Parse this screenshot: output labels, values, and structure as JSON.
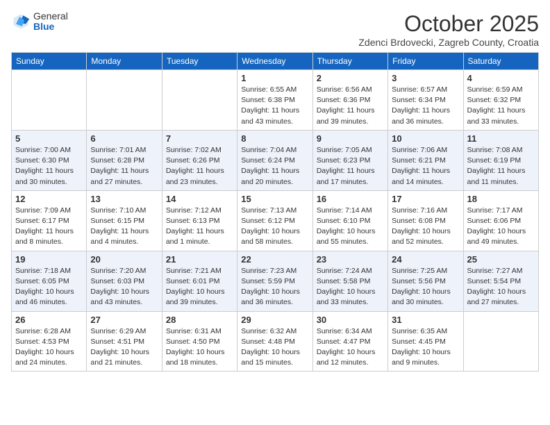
{
  "header": {
    "logo_general": "General",
    "logo_blue": "Blue",
    "month_title": "October 2025",
    "subtitle": "Zdenci Brdovecki, Zagreb County, Croatia"
  },
  "weekdays": [
    "Sunday",
    "Monday",
    "Tuesday",
    "Wednesday",
    "Thursday",
    "Friday",
    "Saturday"
  ],
  "weeks": [
    [
      {
        "day": "",
        "sunrise": "",
        "sunset": "",
        "daylight": ""
      },
      {
        "day": "",
        "sunrise": "",
        "sunset": "",
        "daylight": ""
      },
      {
        "day": "",
        "sunrise": "",
        "sunset": "",
        "daylight": ""
      },
      {
        "day": "1",
        "sunrise": "Sunrise: 6:55 AM",
        "sunset": "Sunset: 6:38 PM",
        "daylight": "Daylight: 11 hours and 43 minutes."
      },
      {
        "day": "2",
        "sunrise": "Sunrise: 6:56 AM",
        "sunset": "Sunset: 6:36 PM",
        "daylight": "Daylight: 11 hours and 39 minutes."
      },
      {
        "day": "3",
        "sunrise": "Sunrise: 6:57 AM",
        "sunset": "Sunset: 6:34 PM",
        "daylight": "Daylight: 11 hours and 36 minutes."
      },
      {
        "day": "4",
        "sunrise": "Sunrise: 6:59 AM",
        "sunset": "Sunset: 6:32 PM",
        "daylight": "Daylight: 11 hours and 33 minutes."
      }
    ],
    [
      {
        "day": "5",
        "sunrise": "Sunrise: 7:00 AM",
        "sunset": "Sunset: 6:30 PM",
        "daylight": "Daylight: 11 hours and 30 minutes."
      },
      {
        "day": "6",
        "sunrise": "Sunrise: 7:01 AM",
        "sunset": "Sunset: 6:28 PM",
        "daylight": "Daylight: 11 hours and 27 minutes."
      },
      {
        "day": "7",
        "sunrise": "Sunrise: 7:02 AM",
        "sunset": "Sunset: 6:26 PM",
        "daylight": "Daylight: 11 hours and 23 minutes."
      },
      {
        "day": "8",
        "sunrise": "Sunrise: 7:04 AM",
        "sunset": "Sunset: 6:24 PM",
        "daylight": "Daylight: 11 hours and 20 minutes."
      },
      {
        "day": "9",
        "sunrise": "Sunrise: 7:05 AM",
        "sunset": "Sunset: 6:23 PM",
        "daylight": "Daylight: 11 hours and 17 minutes."
      },
      {
        "day": "10",
        "sunrise": "Sunrise: 7:06 AM",
        "sunset": "Sunset: 6:21 PM",
        "daylight": "Daylight: 11 hours and 14 minutes."
      },
      {
        "day": "11",
        "sunrise": "Sunrise: 7:08 AM",
        "sunset": "Sunset: 6:19 PM",
        "daylight": "Daylight: 11 hours and 11 minutes."
      }
    ],
    [
      {
        "day": "12",
        "sunrise": "Sunrise: 7:09 AM",
        "sunset": "Sunset: 6:17 PM",
        "daylight": "Daylight: 11 hours and 8 minutes."
      },
      {
        "day": "13",
        "sunrise": "Sunrise: 7:10 AM",
        "sunset": "Sunset: 6:15 PM",
        "daylight": "Daylight: 11 hours and 4 minutes."
      },
      {
        "day": "14",
        "sunrise": "Sunrise: 7:12 AM",
        "sunset": "Sunset: 6:13 PM",
        "daylight": "Daylight: 11 hours and 1 minute."
      },
      {
        "day": "15",
        "sunrise": "Sunrise: 7:13 AM",
        "sunset": "Sunset: 6:12 PM",
        "daylight": "Daylight: 10 hours and 58 minutes."
      },
      {
        "day": "16",
        "sunrise": "Sunrise: 7:14 AM",
        "sunset": "Sunset: 6:10 PM",
        "daylight": "Daylight: 10 hours and 55 minutes."
      },
      {
        "day": "17",
        "sunrise": "Sunrise: 7:16 AM",
        "sunset": "Sunset: 6:08 PM",
        "daylight": "Daylight: 10 hours and 52 minutes."
      },
      {
        "day": "18",
        "sunrise": "Sunrise: 7:17 AM",
        "sunset": "Sunset: 6:06 PM",
        "daylight": "Daylight: 10 hours and 49 minutes."
      }
    ],
    [
      {
        "day": "19",
        "sunrise": "Sunrise: 7:18 AM",
        "sunset": "Sunset: 6:05 PM",
        "daylight": "Daylight: 10 hours and 46 minutes."
      },
      {
        "day": "20",
        "sunrise": "Sunrise: 7:20 AM",
        "sunset": "Sunset: 6:03 PM",
        "daylight": "Daylight: 10 hours and 43 minutes."
      },
      {
        "day": "21",
        "sunrise": "Sunrise: 7:21 AM",
        "sunset": "Sunset: 6:01 PM",
        "daylight": "Daylight: 10 hours and 39 minutes."
      },
      {
        "day": "22",
        "sunrise": "Sunrise: 7:23 AM",
        "sunset": "Sunset: 5:59 PM",
        "daylight": "Daylight: 10 hours and 36 minutes."
      },
      {
        "day": "23",
        "sunrise": "Sunrise: 7:24 AM",
        "sunset": "Sunset: 5:58 PM",
        "daylight": "Daylight: 10 hours and 33 minutes."
      },
      {
        "day": "24",
        "sunrise": "Sunrise: 7:25 AM",
        "sunset": "Sunset: 5:56 PM",
        "daylight": "Daylight: 10 hours and 30 minutes."
      },
      {
        "day": "25",
        "sunrise": "Sunrise: 7:27 AM",
        "sunset": "Sunset: 5:54 PM",
        "daylight": "Daylight: 10 hours and 27 minutes."
      }
    ],
    [
      {
        "day": "26",
        "sunrise": "Sunrise: 6:28 AM",
        "sunset": "Sunset: 4:53 PM",
        "daylight": "Daylight: 10 hours and 24 minutes."
      },
      {
        "day": "27",
        "sunrise": "Sunrise: 6:29 AM",
        "sunset": "Sunset: 4:51 PM",
        "daylight": "Daylight: 10 hours and 21 minutes."
      },
      {
        "day": "28",
        "sunrise": "Sunrise: 6:31 AM",
        "sunset": "Sunset: 4:50 PM",
        "daylight": "Daylight: 10 hours and 18 minutes."
      },
      {
        "day": "29",
        "sunrise": "Sunrise: 6:32 AM",
        "sunset": "Sunset: 4:48 PM",
        "daylight": "Daylight: 10 hours and 15 minutes."
      },
      {
        "day": "30",
        "sunrise": "Sunrise: 6:34 AM",
        "sunset": "Sunset: 4:47 PM",
        "daylight": "Daylight: 10 hours and 12 minutes."
      },
      {
        "day": "31",
        "sunrise": "Sunrise: 6:35 AM",
        "sunset": "Sunset: 4:45 PM",
        "daylight": "Daylight: 10 hours and 9 minutes."
      },
      {
        "day": "",
        "sunrise": "",
        "sunset": "",
        "daylight": ""
      }
    ]
  ]
}
